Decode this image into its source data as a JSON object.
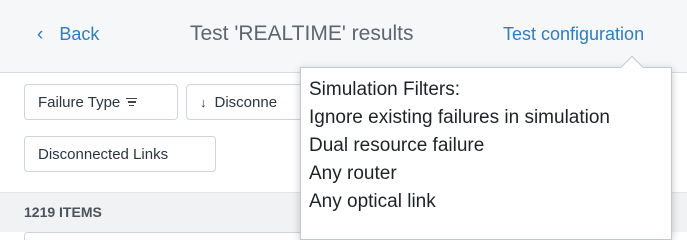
{
  "header": {
    "back_label": "Back",
    "title": "Test 'REALTIME' results",
    "config_link": "Test configuration"
  },
  "filters": {
    "chips": [
      {
        "label": "Failure Type",
        "icon": "filter-icon"
      },
      {
        "label": "Disconne",
        "icon": "sort-down-icon"
      },
      {
        "label": "Disconnected Links"
      }
    ]
  },
  "list": {
    "count_label": "1219 ITEMS"
  },
  "tooltip": {
    "lines": [
      "Simulation Filters:",
      "Ignore existing failures in simulation",
      "Dual resource failure",
      "Any router",
      "Any optical link"
    ]
  },
  "colors": {
    "accent": "#2f7dbe",
    "header_bg": "#f5f7f9",
    "count_bar_bg": "#f0f2f4"
  }
}
